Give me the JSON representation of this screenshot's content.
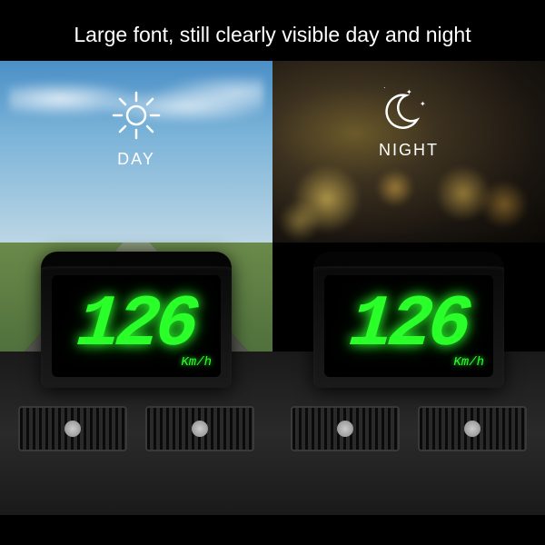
{
  "headline": "Large font, still clearly visible day and night",
  "panels": {
    "day": {
      "label": "DAY",
      "speed_value": "126",
      "speed_unit": "Km/h"
    },
    "night": {
      "label": "NIGHT",
      "speed_value": "126",
      "speed_unit": "Km/h"
    }
  },
  "display": {
    "digit_color": "#2aff2a"
  }
}
